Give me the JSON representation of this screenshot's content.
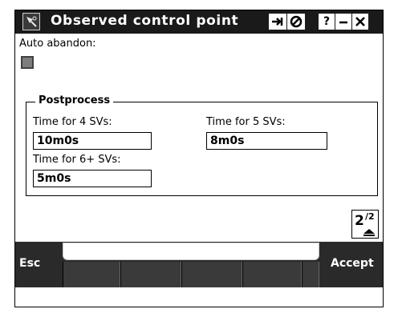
{
  "window": {
    "title": "Observed control point",
    "icons": [
      "satellite-app-icon",
      "enter-icon",
      "cancel-icon",
      "help-icon",
      "minimize-icon",
      "close-icon"
    ],
    "help_label": "?"
  },
  "auto_abandon": {
    "label": "Auto abandon:",
    "checked": false
  },
  "postprocess": {
    "title": "Postprocess",
    "fields": [
      {
        "label": "Time for 4 SVs:",
        "value": "10m0s"
      },
      {
        "label": "Time for 5 SVs:",
        "value": "8m0s"
      },
      {
        "label": "Time for 6+ SVs:",
        "value": "5m0s"
      }
    ]
  },
  "pager": {
    "current": "2",
    "total": "2"
  },
  "softkeys": {
    "left": "Esc",
    "right": "Accept"
  },
  "colors": {
    "titlebar": "#1a1a1a",
    "softkey_bar": "#2a2a2a",
    "checkbox": "#7d7d7d"
  }
}
